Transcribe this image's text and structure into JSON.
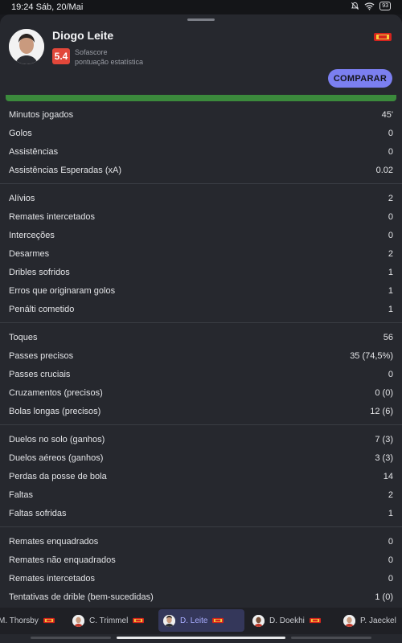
{
  "status_bar": {
    "time": "19:24 Sáb, 20/Mai",
    "battery": "93"
  },
  "player": {
    "name": "Diogo Leite",
    "rating": "5.4",
    "rating_source": "Sofascore",
    "rating_caption": "pontuação estatística",
    "compare_label": "COMPARAR"
  },
  "groups": [
    [
      {
        "label": "Minutos jogados",
        "value": "45'"
      },
      {
        "label": "Golos",
        "value": "0"
      },
      {
        "label": "Assistências",
        "value": "0"
      },
      {
        "label": "Assistências Esperadas (xA)",
        "value": "0.02"
      }
    ],
    [
      {
        "label": "Alívios",
        "value": "2"
      },
      {
        "label": "Remates intercetados",
        "value": "0"
      },
      {
        "label": "Interceções",
        "value": "0"
      },
      {
        "label": "Desarmes",
        "value": "2"
      },
      {
        "label": "Dribles sofridos",
        "value": "1"
      },
      {
        "label": "Erros que originaram golos",
        "value": "1"
      },
      {
        "label": "Penálti cometido",
        "value": "1"
      }
    ],
    [
      {
        "label": "Toques",
        "value": "56"
      },
      {
        "label": "Passes precisos",
        "value": "35 (74,5%)"
      },
      {
        "label": "Passes cruciais",
        "value": "0"
      },
      {
        "label": "Cruzamentos (precisos)",
        "value": "0 (0)"
      },
      {
        "label": "Bolas longas (precisos)",
        "value": "12 (6)"
      }
    ],
    [
      {
        "label": "Duelos no solo (ganhos)",
        "value": "7 (3)"
      },
      {
        "label": "Duelos aéreos (ganhos)",
        "value": "3 (3)"
      },
      {
        "label": "Perdas da posse de bola",
        "value": "14"
      },
      {
        "label": "Faltas",
        "value": "2"
      },
      {
        "label": "Faltas sofridas",
        "value": "1"
      }
    ],
    [
      {
        "label": "Remates enquadrados",
        "value": "0"
      },
      {
        "label": "Remates não enquadrados",
        "value": "0"
      },
      {
        "label": "Remates intercetados",
        "value": "0"
      },
      {
        "label": "Tentativas de drible (bem-sucedidas)",
        "value": "1 (0)"
      }
    ]
  ],
  "bottom_nav": {
    "players": [
      {
        "name": "M. Thorsby"
      },
      {
        "name": "C. Trimmel"
      },
      {
        "name": "D. Leite"
      },
      {
        "name": "D. Doekhi"
      },
      {
        "name": "P. Jaeckel"
      }
    ],
    "active_index": 2
  },
  "colors": {
    "accent": "#7b7ff0",
    "rating_bg": "#e2473a",
    "pitch_green": "#3b8a3c"
  }
}
